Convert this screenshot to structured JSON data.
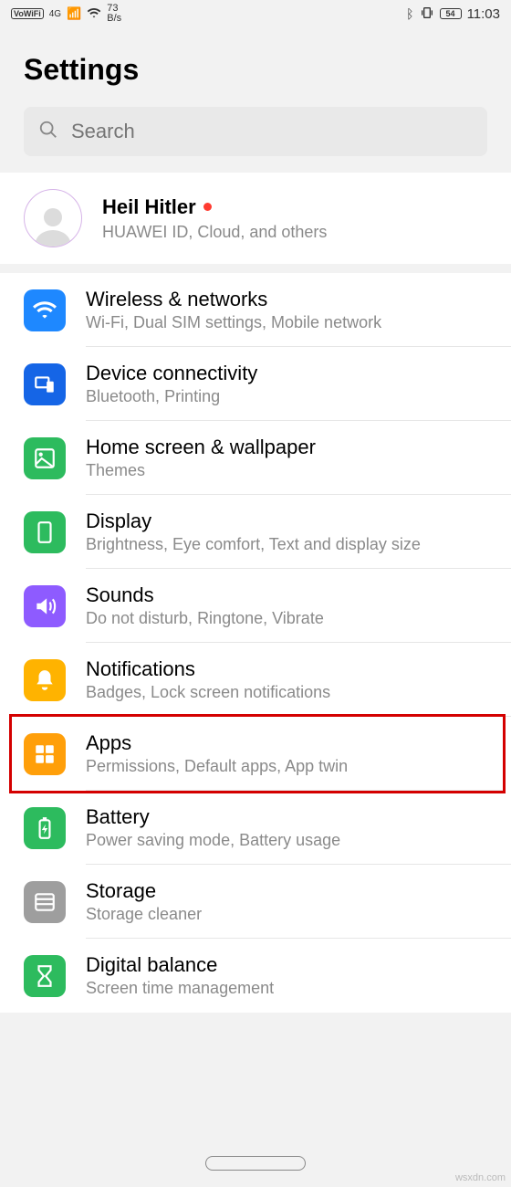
{
  "status": {
    "vowifi": "VoWiFi",
    "net_tag": "4G",
    "speed_val": "73",
    "speed_unit": "B/s",
    "battery": "54",
    "time": "11:03"
  },
  "page_title": "Settings",
  "search": {
    "placeholder": "Search"
  },
  "account": {
    "name": "Heil Hitler",
    "sub": "HUAWEI ID, Cloud, and others"
  },
  "items": [
    {
      "title": "Wireless & networks",
      "sub": "Wi-Fi, Dual SIM settings, Mobile network",
      "color": "c-blue1",
      "icon": "wifi"
    },
    {
      "title": "Device connectivity",
      "sub": "Bluetooth, Printing",
      "color": "c-blue2",
      "icon": "devices"
    },
    {
      "title": "Home screen & wallpaper",
      "sub": "Themes",
      "color": "c-green",
      "icon": "image"
    },
    {
      "title": "Display",
      "sub": "Brightness, Eye comfort, Text and display size",
      "color": "c-green",
      "icon": "display"
    },
    {
      "title": "Sounds",
      "sub": "Do not disturb, Ringtone, Vibrate",
      "color": "c-purple",
      "icon": "sound"
    },
    {
      "title": "Notifications",
      "sub": "Badges, Lock screen notifications",
      "color": "c-yellow",
      "icon": "bell"
    },
    {
      "title": "Apps",
      "sub": "Permissions, Default apps, App twin",
      "color": "c-orange",
      "icon": "apps",
      "highlight": true
    },
    {
      "title": "Battery",
      "sub": "Power saving mode, Battery usage",
      "color": "c-green",
      "icon": "battery"
    },
    {
      "title": "Storage",
      "sub": "Storage cleaner",
      "color": "c-grey",
      "icon": "storage"
    },
    {
      "title": "Digital balance",
      "sub": "Screen time management",
      "color": "c-green",
      "icon": "hourglass"
    }
  ],
  "watermark": "wsxdn.com"
}
